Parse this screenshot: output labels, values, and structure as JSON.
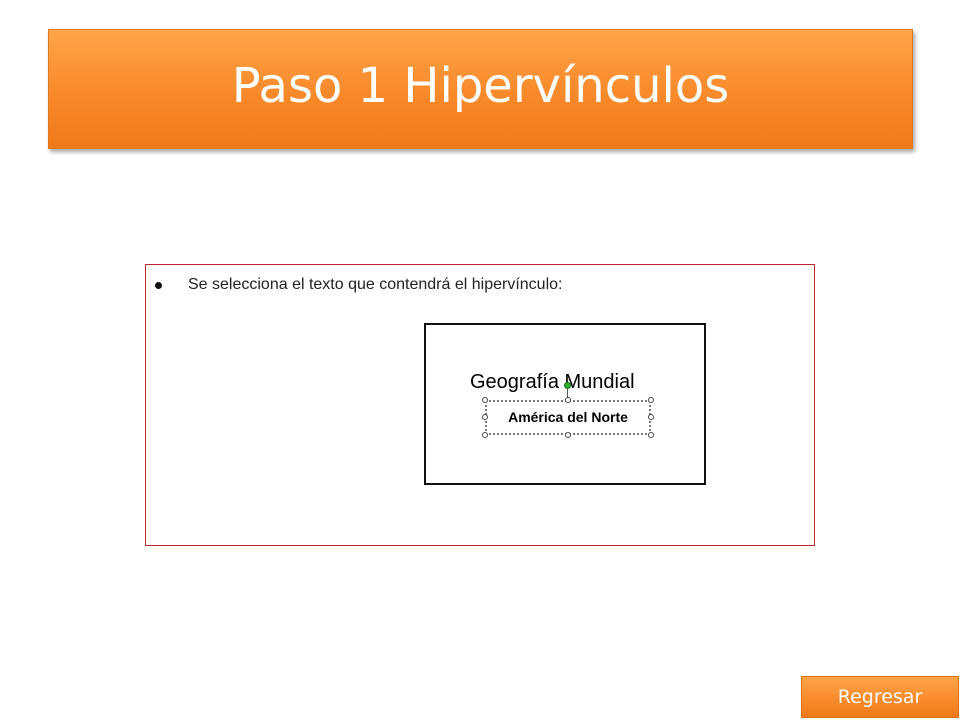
{
  "slide": {
    "title": "Paso 1 Hipervínculos"
  },
  "content": {
    "bullet_text": "Se selecciona el texto que contendrá el hipervínculo:",
    "preview": {
      "title": "Geografía Mundial",
      "selected_text": "América del Norte"
    }
  },
  "navigation": {
    "back_label": "Regresar"
  },
  "colors": {
    "banner_orange": "#f8892a",
    "frame_red": "#c0262c",
    "rotate_handle_green": "#2fb12f"
  }
}
